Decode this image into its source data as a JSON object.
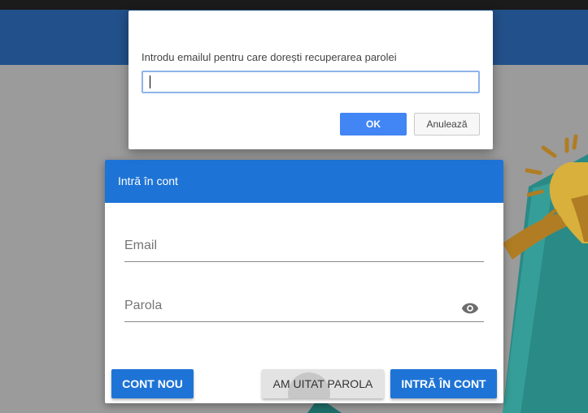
{
  "dialog": {
    "message": "Introdu emailul pentru care dorești recuperarea parolei",
    "input_value": "",
    "ok_label": "OK",
    "cancel_label": "Anulează"
  },
  "login": {
    "title": "Intră în cont",
    "email_placeholder": "Email",
    "password_placeholder": "Parola",
    "new_account_label": "CONT NOU",
    "forgot_label": "AM UITAT PAROLA",
    "login_label": "INTRĂ ÎN CONT"
  },
  "icons": {
    "password_visibility": "eye-icon"
  },
  "colors": {
    "app_bar": "#22508a",
    "primary": "#1e74d6",
    "dialog_ok": "#4285f4",
    "logo_teal": "#2a8a86",
    "logo_gold": "#b07d24"
  }
}
